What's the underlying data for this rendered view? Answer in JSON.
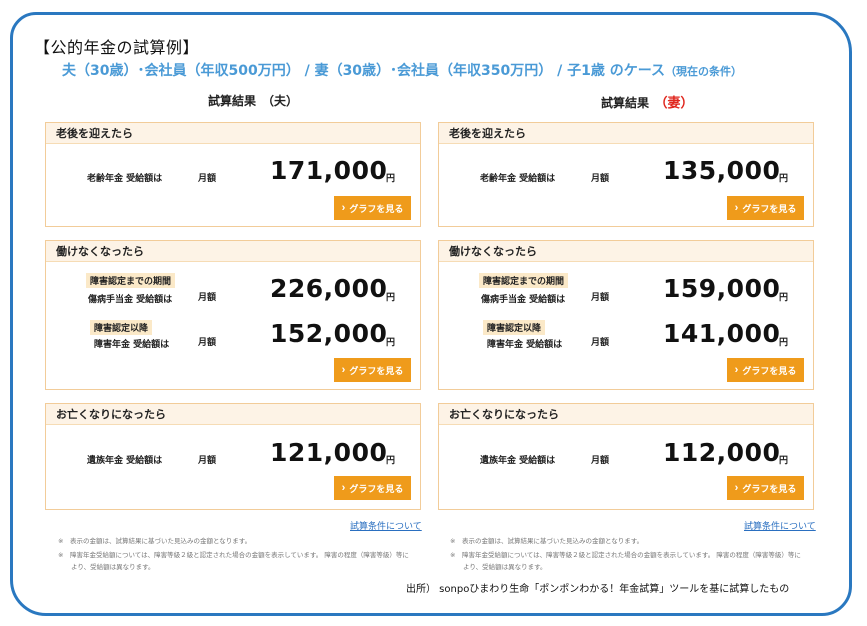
{
  "title": "【公的年金の試算例】",
  "case": {
    "main": "夫（30歳）･会社員（年収500万円） / 妻（30歳）･会社員（年収350万円） /  子1歳  のケース",
    "sub": "（現在の条件）"
  },
  "columns": [
    {
      "heading": "試算結果　（夫）",
      "heading_prefix": "試算結果",
      "heading_person": "（夫）",
      "old_age": {
        "header": "老後を迎えたら",
        "label": "老齢年金 受給額は",
        "monthly": "月額",
        "amount": "171,000",
        "unit": "円",
        "button": "グラフを見る"
      },
      "disability": {
        "header": "働けなくなったら",
        "before_tag": "障害認定までの期間",
        "before_label": "傷病手当金 受給額は",
        "before_monthly": "月額",
        "before_amount": "226,000",
        "before_unit": "円",
        "after_tag": "障害認定以降",
        "after_label": "障害年金 受給額は",
        "after_monthly": "月額",
        "after_amount": "152,000",
        "after_unit": "円",
        "button": "グラフを見る"
      },
      "death": {
        "header": "お亡くなりになったら",
        "label": "遺族年金 受給額は",
        "monthly": "月額",
        "amount": "121,000",
        "unit": "円",
        "button": "グラフを見る"
      },
      "conditions_link": "試算条件について",
      "notes": [
        "※　表示の金額は、試算結果に基づいた見込みの金額となります。",
        "※　障害年金受給額については、障害等級２級と認定された場合の金額を表示しています。 障害の程度（障害等級）等に",
        "　　より、受給額は異なります。"
      ]
    },
    {
      "heading_prefix": "試算結果",
      "heading_person": "（妻）",
      "old_age": {
        "header": "老後を迎えたら",
        "label": "老齢年金 受給額は",
        "monthly": "月額",
        "amount": "135,000",
        "unit": "円",
        "button": "グラフを見る"
      },
      "disability": {
        "header": "働けなくなったら",
        "before_tag": "障害認定までの期間",
        "before_label": "傷病手当金 受給額は",
        "before_monthly": "月額",
        "before_amount": "159,000",
        "before_unit": "円",
        "after_tag": "障害認定以降",
        "after_label": "障害年金 受給額は",
        "after_monthly": "月額",
        "after_amount": "141,000",
        "after_unit": "円",
        "button": "グラフを見る"
      },
      "death": {
        "header": "お亡くなりになったら",
        "label": "遺族年金 受給額は",
        "monthly": "月額",
        "amount": "112,000",
        "unit": "円",
        "button": "グラフを見る"
      },
      "conditions_link": "試算条件について",
      "notes": [
        "※　表示の金額は、試算結果に基づいた見込みの金額となります。",
        "※　障害年金受給額については、障害等級２級と認定された場合の金額を表示しています。 障害の程度（障害等級）等に",
        "　　より、受給額は異なります。"
      ]
    }
  ],
  "source": "出所） sonpoひまわり生命「ポンポンわかる！年金試算」ツールを基に試算したもの",
  "colors": {
    "frame": "#2a78c0",
    "case_line": "#4a9ad6",
    "card_border": "#f2cc99",
    "card_header_bg": "#fdf3e6",
    "button": "#ef9b1b",
    "wife_accent": "#e0261d",
    "link": "#2a6fc0"
  }
}
